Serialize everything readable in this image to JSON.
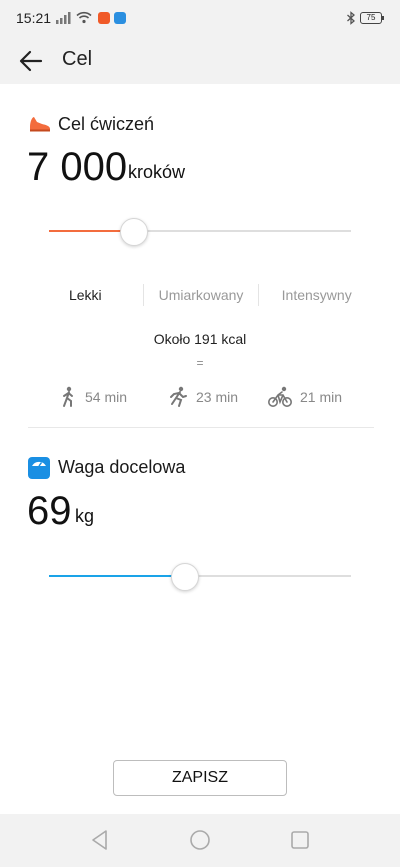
{
  "status_bar": {
    "time": "15:21",
    "battery": "75"
  },
  "app_bar": {
    "title": "Cel"
  },
  "exercise": {
    "title": "Cel ćwiczeń",
    "value": "7 000",
    "unit": "kroków",
    "slider_fraction": 0.28,
    "accent": "#f36c3d",
    "levels": [
      "Lekki",
      "Umiarkowany",
      "Intensywny"
    ],
    "active_level": "Lekki",
    "kcal": "Około 191 kcal",
    "equals": "=",
    "activities": [
      {
        "icon": "walking-icon",
        "label": "54 min"
      },
      {
        "icon": "running-icon",
        "label": "23 min"
      },
      {
        "icon": "cycling-icon",
        "label": "21 min"
      }
    ]
  },
  "weight": {
    "title": "Waga docelowa",
    "value": "69",
    "unit": "kg",
    "slider_fraction": 0.45,
    "accent": "#1aa3e8"
  },
  "save_label": "ZAPISZ"
}
